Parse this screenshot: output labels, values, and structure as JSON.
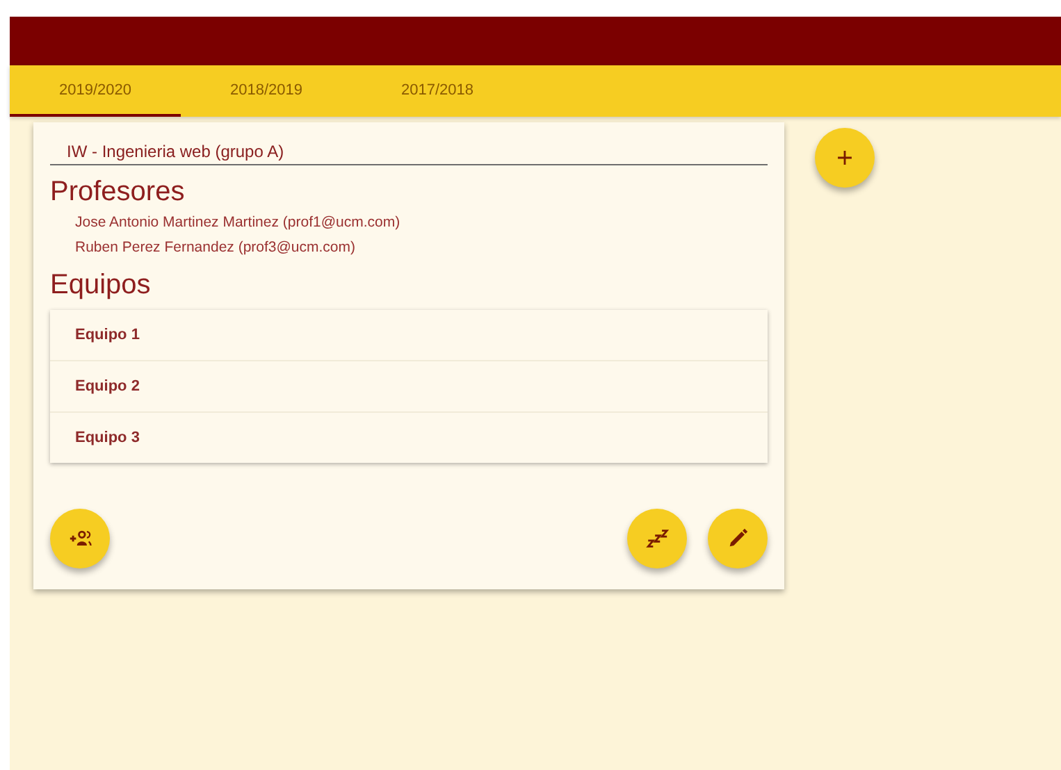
{
  "tabs": [
    {
      "label": "2019/2020",
      "selected": true
    },
    {
      "label": "2018/2019",
      "selected": false
    },
    {
      "label": "2017/2018",
      "selected": false
    }
  ],
  "card": {
    "course": {
      "value": "IW - Ingenieria web (grupo A)"
    },
    "teachers_title": "Profesores",
    "teachers": [
      "Jose Antonio Martinez Martinez (prof1@ucm.com)",
      "Ruben Perez Fernandez (prof3@ucm.com)"
    ],
    "teams_title": "Equipos",
    "teams": [
      "Equipo 1",
      "Equipo 2",
      "Equipo 3"
    ],
    "actions": [
      {
        "kind": "add-group"
      },
      {
        "kind": "sleep"
      },
      {
        "kind": "edit"
      }
    ]
  },
  "fab": {
    "kind": "add"
  }
}
